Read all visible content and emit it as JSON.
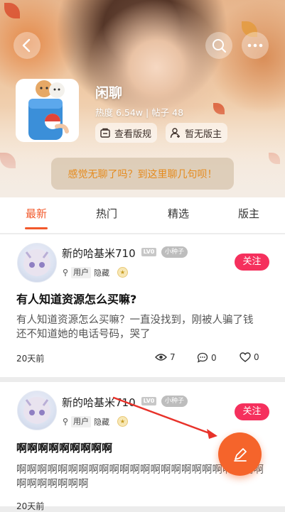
{
  "board": {
    "title": "闲聊",
    "stats": "热度 6.54w | 帖子 48",
    "rules_label": "查看版规",
    "moderator_label": "暂无版主",
    "banner": "感觉无聊了吗？到这里聊几句呗！"
  },
  "tabs": [
    {
      "label": "最新",
      "active": true
    },
    {
      "label": "热门",
      "active": false
    },
    {
      "label": "精选",
      "active": false
    },
    {
      "label": "版主",
      "active": false
    }
  ],
  "posts": [
    {
      "username": "新的哈基米710",
      "level": "LV0",
      "badge": "小种子",
      "role": "用户",
      "visibility": "隐藏",
      "follow_label": "关注",
      "title": "有人知道资源怎么买嘛?",
      "body": "有人知道资源怎么买嘛？一直没找到，刚被人骗了钱 还不知道她的电话号码，哭了",
      "time": "20天前",
      "views": "7",
      "comments": "0",
      "likes": "0"
    },
    {
      "username": "新的哈基米710",
      "level": "LV0",
      "badge": "小种子",
      "role": "用户",
      "visibility": "隐藏",
      "follow_label": "关注",
      "title": "啊啊啊啊啊啊啊啊啊",
      "body": "啊啊啊啊啊啊啊啊啊啊啊啊啊啊啊啊啊啊啊啊啊啊啊啊啊啊啊啊啊啊啊",
      "time": "20天前"
    }
  ],
  "colors": {
    "accent": "#f2592b",
    "follow": "#f5305d",
    "banner_text": "#e58a1c",
    "annotation_arrow": "#e8322a"
  },
  "icons": [
    "back-icon",
    "search-icon",
    "more-icon",
    "rules-icon",
    "moderator-icon",
    "eye-icon",
    "comment-icon",
    "heart-icon",
    "edit-icon"
  ]
}
